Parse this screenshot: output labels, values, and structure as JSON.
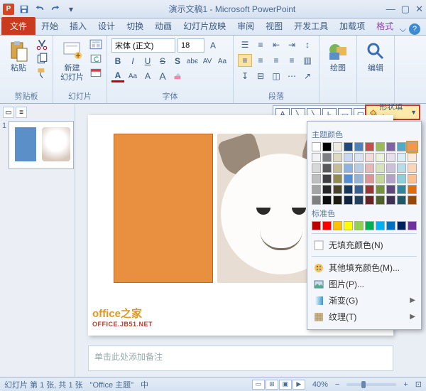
{
  "title": "演示文稿1 - Microsoft PowerPoint",
  "tabs": {
    "file": "文件",
    "items": [
      "开始",
      "插入",
      "设计",
      "切换",
      "动画",
      "幻灯片放映",
      "审阅",
      "视图",
      "开发工具",
      "加载项"
    ],
    "context": "格式"
  },
  "ribbon": {
    "clipboard": {
      "label": "剪贴板",
      "paste": "粘贴"
    },
    "slides": {
      "label": "幻灯片",
      "new": "新建\n幻灯片"
    },
    "font": {
      "label": "字体",
      "name": "宋体 (正文)",
      "size": "18"
    },
    "paragraph": {
      "label": "段落"
    },
    "drawing": {
      "label": "绘图",
      "btn": "绘图"
    },
    "editing": {
      "label": "编辑",
      "btn": "编辑"
    }
  },
  "fill_button": "形状填充",
  "dropdown": {
    "theme_header": "主题颜色",
    "theme_row1": [
      "#ffffff",
      "#000000",
      "#eeece1",
      "#1f497d",
      "#4f81bd",
      "#c0504d",
      "#9bbb59",
      "#8064a2",
      "#4bacc6",
      "#f79646"
    ],
    "theme_shades": [
      [
        "#f2f2f2",
        "#7f7f7f",
        "#ddd9c3",
        "#c6d9f0",
        "#dbe5f1",
        "#f2dcdb",
        "#ebf1dd",
        "#e5e0ec",
        "#dbeef3",
        "#fdeada"
      ],
      [
        "#d8d8d8",
        "#595959",
        "#c4bd97",
        "#8db3e2",
        "#b8cce4",
        "#e5b9b7",
        "#d7e3bc",
        "#ccc1d9",
        "#b7dde8",
        "#fbd5b5"
      ],
      [
        "#bfbfbf",
        "#3f3f3f",
        "#938953",
        "#548dd4",
        "#95b3d7",
        "#d99694",
        "#c3d69b",
        "#b2a2c7",
        "#92cddc",
        "#fac08f"
      ],
      [
        "#a5a5a5",
        "#262626",
        "#494429",
        "#17365d",
        "#366092",
        "#953734",
        "#76923c",
        "#5f497a",
        "#31859b",
        "#e36c09"
      ],
      [
        "#7f7f7f",
        "#0c0c0c",
        "#1d1b10",
        "#0f243e",
        "#244061",
        "#632423",
        "#4f6128",
        "#3f3151",
        "#205867",
        "#974806"
      ]
    ],
    "standard_header": "标准色",
    "standard": [
      "#c00000",
      "#ff0000",
      "#ffc000",
      "#ffff00",
      "#92d050",
      "#00b050",
      "#00b0f0",
      "#0070c0",
      "#002060",
      "#7030a0"
    ],
    "no_fill": "无填充颜色(N)",
    "more_colors": "其他填充颜色(M)...",
    "picture": "图片(P)...",
    "gradient": "渐变(G)",
    "texture": "纹理(T)",
    "gallery_label": "绘"
  },
  "watermark": {
    "main": "office之家",
    "sub": "OFFICE.JB51.NET"
  },
  "notes_placeholder": "单击此处添加备注",
  "status": {
    "slide": "幻灯片 第 1 张, 共 1 张",
    "theme": "\"Office 主题\"",
    "lang": "中",
    "zoom": "40%"
  },
  "thumb_num": "1"
}
